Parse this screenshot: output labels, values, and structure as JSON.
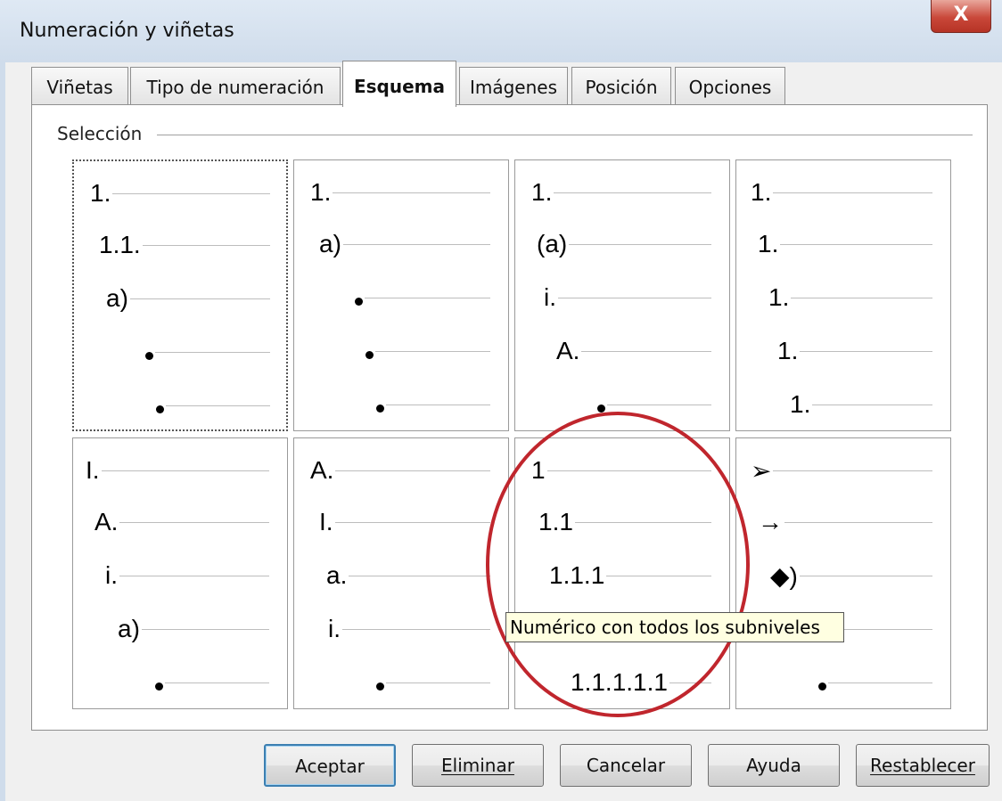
{
  "window": {
    "title": "Numeración y viñetas",
    "close_glyph": "X"
  },
  "tabs": [
    {
      "label": "Viñetas"
    },
    {
      "label": "Tipo de numeración"
    },
    {
      "label": "Esquema",
      "active": true
    },
    {
      "label": "Imágenes"
    },
    {
      "label": "Posición"
    },
    {
      "label": "Opciones"
    }
  ],
  "group": {
    "label": "Selección"
  },
  "schemes": [
    {
      "levels": [
        "1.",
        "1.1.",
        "a)",
        "•",
        "•"
      ],
      "selected": true
    },
    {
      "levels": [
        "1.",
        "a)",
        "•",
        "•",
        "•"
      ]
    },
    {
      "levels": [
        "1.",
        "(a)",
        "i.",
        "A.",
        "•"
      ]
    },
    {
      "levels": [
        "1.",
        "1.",
        "1.",
        "1.",
        "1."
      ]
    },
    {
      "levels": [
        "I.",
        "A.",
        "i.",
        "a)",
        "•"
      ]
    },
    {
      "levels": [
        "A.",
        "I.",
        "a.",
        "i.",
        "•"
      ]
    },
    {
      "levels": [
        "1",
        "1.1",
        "1.1.1",
        "",
        "1.1.1.1.1"
      ]
    },
    {
      "levels": [
        "➢",
        "→",
        "◆)",
        "",
        "•"
      ]
    }
  ],
  "tooltip": {
    "text": "Numérico con todos los subniveles"
  },
  "annotation_color": "#c0262d",
  "buttons": {
    "accept": "Aceptar",
    "delete": "Eliminar",
    "cancel": "Cancelar",
    "help": "Ayuda",
    "reset": "Restablecer"
  }
}
